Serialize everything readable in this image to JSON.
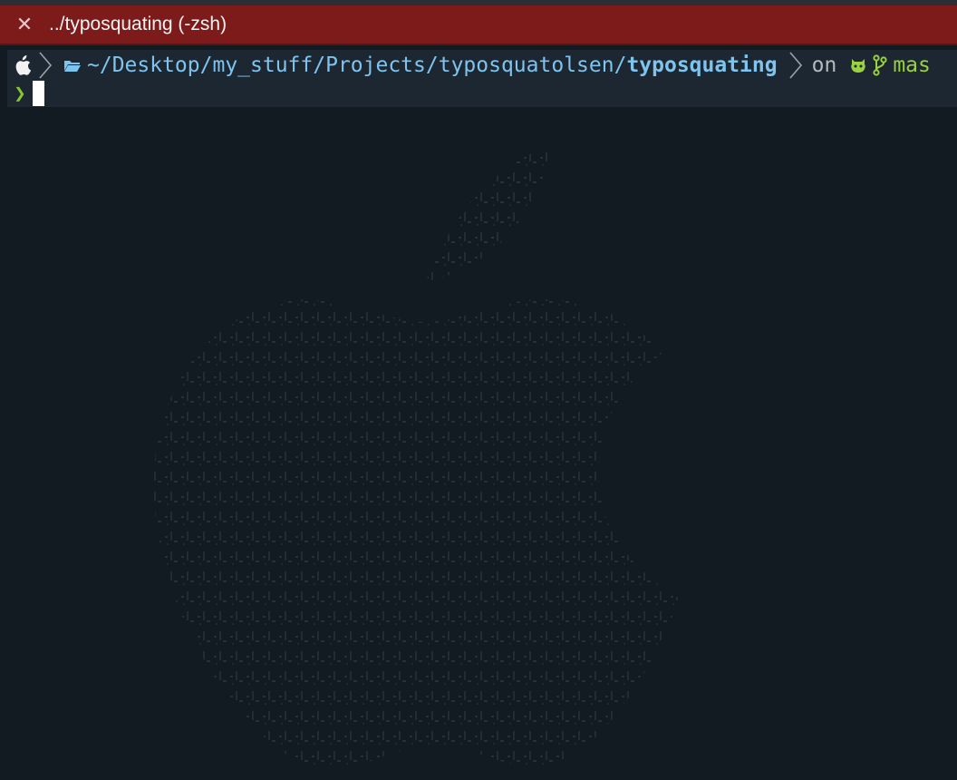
{
  "window": {
    "tab_title": "../typosquating (-zsh)",
    "close_label": "✕"
  },
  "prompt": {
    "path_prefix": "~/Desktop/my_stuff/Projects/typosquatolsen/",
    "path_current": "typosquating",
    "on_label": "on",
    "branch": "mas",
    "arrow": "❯"
  },
  "colors": {
    "tab_background": "#7d1b1b",
    "terminal_background": "#131b22",
    "path": "#7ec4ef",
    "branch": "#9ad13e",
    "prompt_arrow": "#86c633"
  },
  "icons": [
    "apple-icon",
    "folder-icon",
    "github-octocat-icon",
    "git-branch-icon",
    "close-icon"
  ]
}
